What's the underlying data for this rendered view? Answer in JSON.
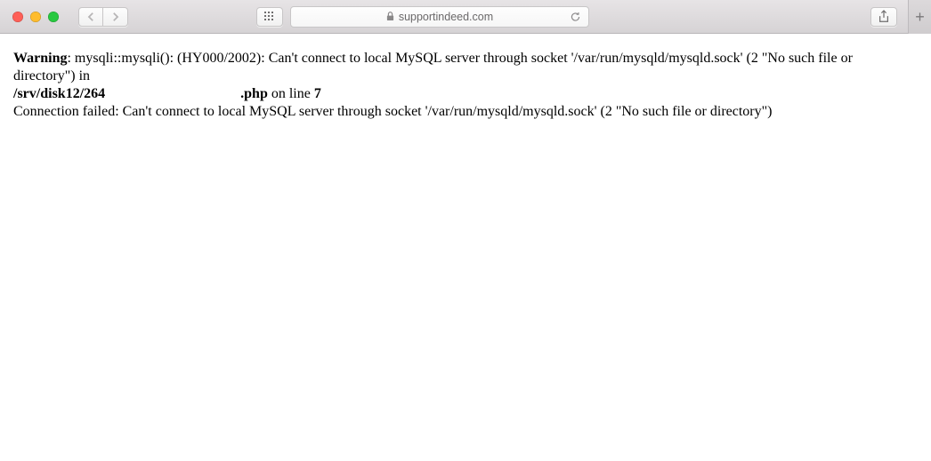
{
  "toolbar": {
    "address_host": "supportindeed.com"
  },
  "error": {
    "warning_label": "Warning",
    "warning_body": ": mysqli::mysqli(): (HY000/2002): Can't connect to local MySQL server through socket '/var/run/mysqld/mysqld.sock' (2 \"No such file or directory\") in ",
    "path_prefix": "/srv/disk12/264",
    "path_suffix": ".php",
    "on_line_text": " on line ",
    "line_number": "7",
    "connection_failed": "Connection failed: Can't connect to local MySQL server through socket '/var/run/mysqld/mysqld.sock' (2 \"No such file or directory\")"
  }
}
